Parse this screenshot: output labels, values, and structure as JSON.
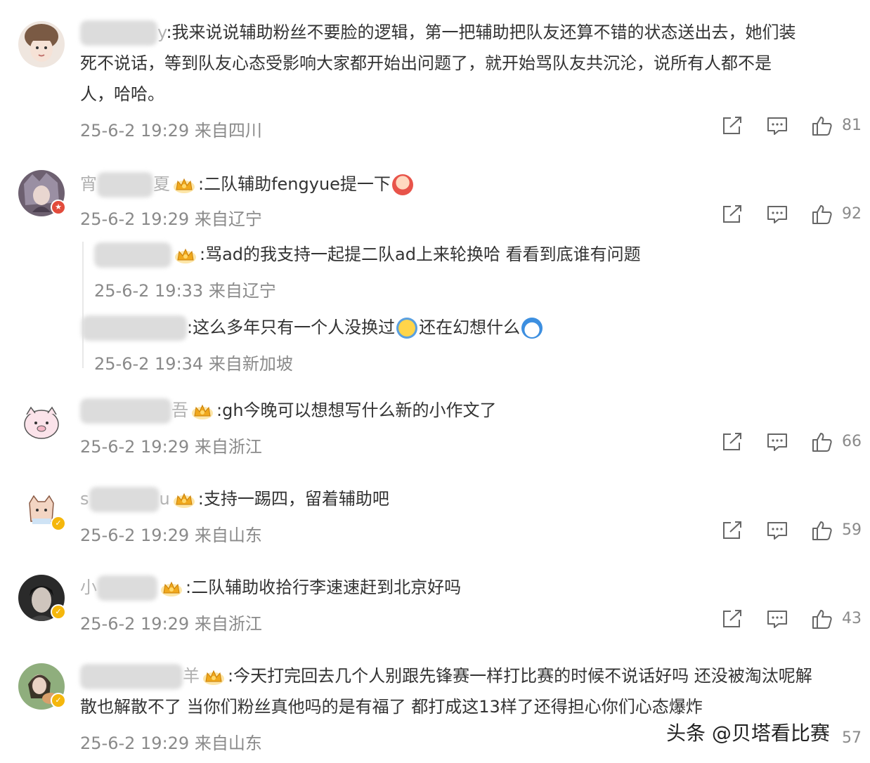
{
  "comments": [
    {
      "text_line1": ":我来说说辅助粉丝不要脸的逻辑，第一把辅助把队友还算不错的状态送出去，她们装",
      "text_line2": "死不说话，等到队友心态受影响大家都开始出问题了，就开始骂队友共沉沦，说所有人都不是",
      "text_line3": "人，哈哈。",
      "meta": "25-6-2 19:29 来自四川",
      "likes": "81"
    },
    {
      "text": ":二队辅助fengyue提一下",
      "meta": "25-6-2 19:29 来自辽宁",
      "likes": "92",
      "replies": [
        {
          "text": ":骂ad的我支持一起提二队ad上来轮换哈 看看到底谁有问题",
          "meta": "25-6-2 19:33 来自辽宁"
        },
        {
          "text_a": ":这么多年只有一个人没换过",
          "text_b": "还在幻想什么",
          "meta": "25-6-2 19:34 来自新加坡"
        }
      ]
    },
    {
      "text": ":gh今晚可以想想写什么新的小作文了",
      "meta": "25-6-2 19:29 来自浙江",
      "likes": "66"
    },
    {
      "text": ":支持一踢四，留着辅助吧",
      "meta": "25-6-2 19:29 来自山东",
      "likes": "59"
    },
    {
      "text": ":二队辅助收拾行李速速赶到北京好吗",
      "meta": "25-6-2 19:29 来自浙江",
      "likes": "43"
    },
    {
      "text_line1": ":今天打完回去几个人别跟先锋赛一样打比赛的时候不说话好吗 还没被淘汰呢解",
      "text_line2": "散也解散不了 当你们粉丝真他吗的是有福了 都打成这13样了还得担心你们心态爆炸",
      "meta": "25-6-2 19:29 来自山东",
      "likes": "57"
    }
  ],
  "name_fragments": {
    "c1_tail": "y",
    "c2_head": "宵",
    "c2_tail": "夏",
    "c3_head": "",
    "c3_tail": "吾",
    "c4_head": "s",
    "c4_tail": "u",
    "c5_head": "小",
    "c5_tail": "",
    "c6_tail": "羊"
  },
  "watermark": "头条 @贝塔看比赛",
  "icons": [
    "share-icon",
    "comment-icon",
    "like-icon",
    "crown-badge-icon",
    "verified-badge-icon"
  ],
  "colors": {
    "text": "#333333",
    "meta": "#8a8a8a",
    "badge_gold": "#f5b70c",
    "badge_red": "#e24b3b"
  }
}
